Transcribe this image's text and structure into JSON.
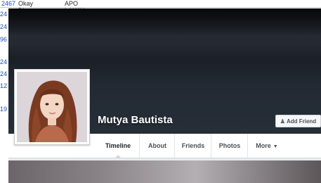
{
  "spreadsheet": {
    "top_row": {
      "id": "2467",
      "name": "Okay Dito",
      "alliance": "APO LAKAY-BONG BONG MARCOS ALLIANCE"
    },
    "left_fragments": [
      "24",
      "24",
      "96",
      "24",
      "24",
      "12",
      "19"
    ]
  },
  "profile": {
    "name": "Mutya Bautista",
    "add_friend_label": "Add Friend",
    "add_friend_icon": "person-add-icon"
  },
  "tabs": [
    {
      "label": "Timeline",
      "active": true
    },
    {
      "label": "About",
      "active": false
    },
    {
      "label": "Friends",
      "active": false
    },
    {
      "label": "Photos",
      "active": false
    },
    {
      "label": "More",
      "active": false,
      "has_dropdown": true
    }
  ],
  "colors": {
    "cover_dark": "#1b1f26",
    "link_blue": "#1a4fb8",
    "tab_text": "#4b4f56"
  }
}
